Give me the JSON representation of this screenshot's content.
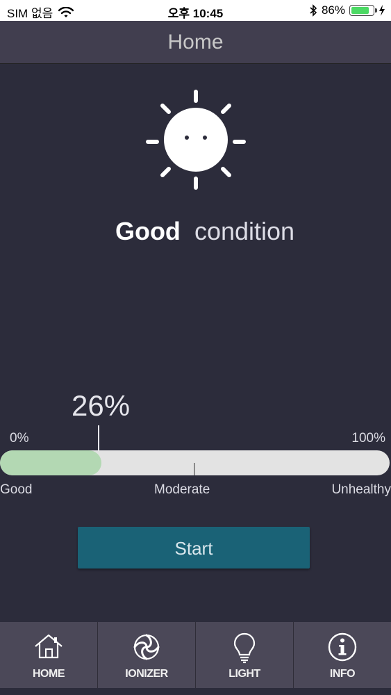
{
  "status_bar": {
    "carrier": "SIM 없음",
    "time": "오후 10:45",
    "battery_percent": "86%",
    "battery_level": 0.86,
    "battery_color": "#4cd964"
  },
  "header": {
    "title": "Home"
  },
  "condition": {
    "icon": "sun-face-icon",
    "status": "Good",
    "suffix": "condition"
  },
  "gauge": {
    "value_label": "26%",
    "value": 0.26,
    "min_label": "0%",
    "max_label": "100%",
    "scale_labels": {
      "good": "Good",
      "moderate": "Moderate",
      "unhealthy": "Unhealthy"
    },
    "fill_color": "#b3d8b3",
    "track_color": "#e3e3e3"
  },
  "start_button": {
    "label": "Start",
    "color": "#1a6276"
  },
  "nav": {
    "tabs": [
      {
        "label": "HOME",
        "icon": "home-icon"
      },
      {
        "label": "IONIZER",
        "icon": "ionizer-swirl-icon"
      },
      {
        "label": "LIGHT",
        "icon": "lightbulb-icon"
      },
      {
        "label": "INFO",
        "icon": "info-icon"
      }
    ]
  }
}
